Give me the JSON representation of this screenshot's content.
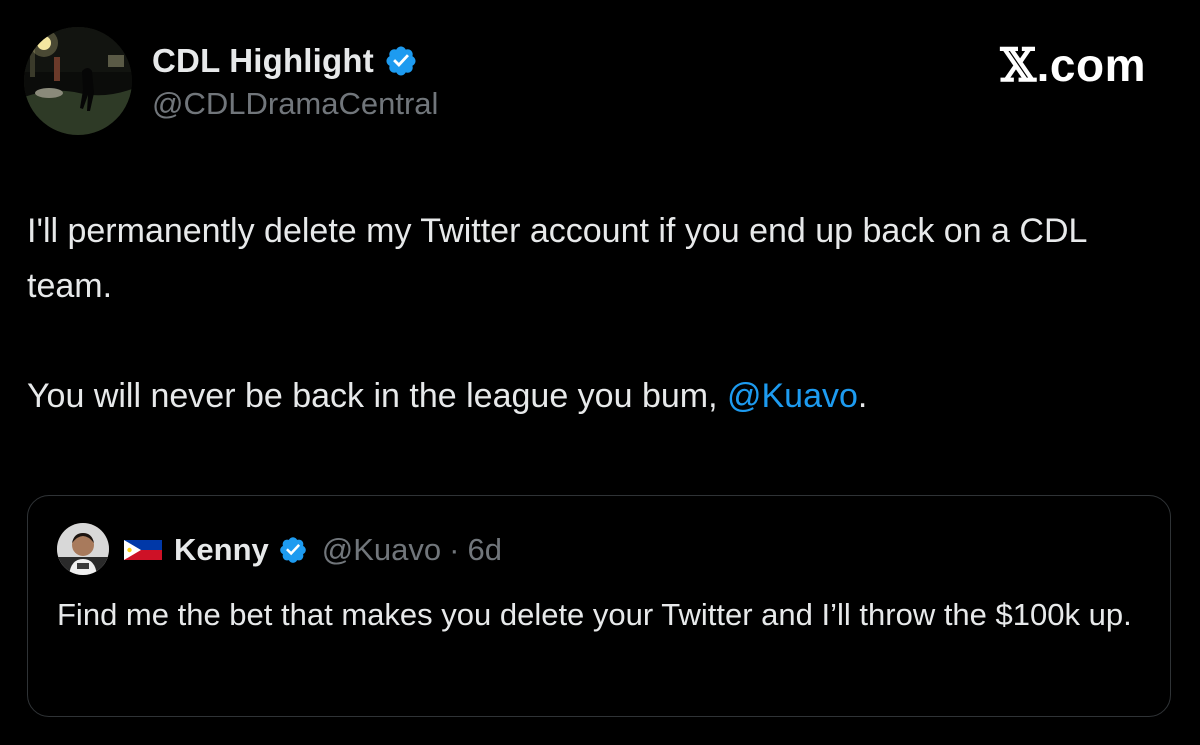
{
  "author": {
    "display_name": "CDL Highlight",
    "handle": "@CDLDramaCentral",
    "verified_icon": "verified-badge-icon"
  },
  "brand": {
    "x_glyph": "𝕏",
    "suffix": ".com"
  },
  "post": {
    "line1": "I'll permanently delete my Twitter account if you end up back on a CDL team.",
    "line2_prefix": "You will never be back in the league you bum, ",
    "line2_mention": "@Kuavo",
    "line2_suffix": "."
  },
  "quoted": {
    "flag_icon": "philippines-flag-icon",
    "display_name": "Kenny",
    "handle": "@Kuavo",
    "separator": "·",
    "time": "6d",
    "text": "Find me the bet that makes you delete your Twitter and I’ll throw the $100k up."
  },
  "colors": {
    "background": "#000000",
    "text": "#e7e9ea",
    "muted": "#71767b",
    "link": "#1d9bf0",
    "border": "#2f3336"
  }
}
